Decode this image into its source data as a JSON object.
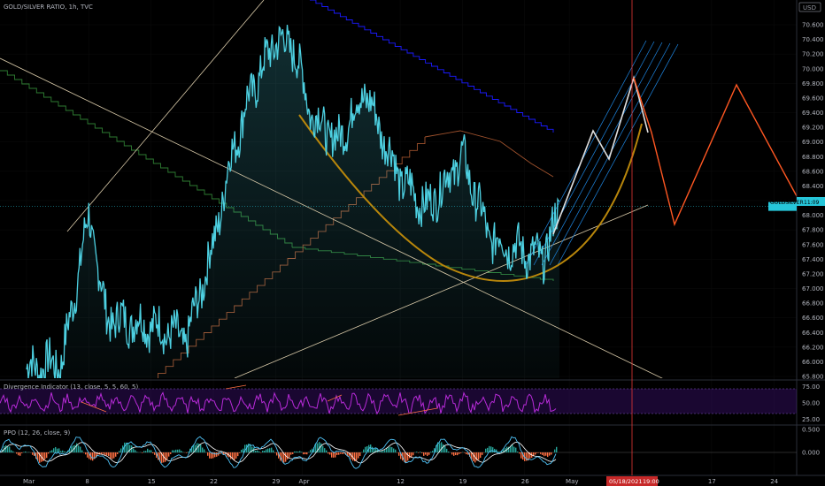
{
  "header": {
    "symbol_title": "GOLD/SILVER RATIO, 1h, TVC",
    "currency": "USD"
  },
  "price_badge": {
    "symbol": "GOLDSILVER",
    "countdown": "11:09",
    "color": "#26c6da"
  },
  "crosshair_time_label": "05/18/2021",
  "crosshair_time_extra": "19:00",
  "colors": {
    "price": "#4dd0e1",
    "divergence": "#b82bd9",
    "ppo_line": "#4fc3f7",
    "ppo_signal": "#ffffff",
    "projection_orange": "#ff5722",
    "projection_white": "#e0e0e0",
    "channel_blue": "#1e88e5",
    "trend_blue": "#1a1aff",
    "trend_green": "#2e7d32",
    "trend_orange": "#a0522d",
    "cup": "#b8860b"
  },
  "chart_data": [
    {
      "type": "line",
      "pane": "price",
      "title": "GOLD/SILVER RATIO, 1h, TVC",
      "y_axis_ticks": [
        "70.600",
        "70.400",
        "70.200",
        "70.000",
        "69.800",
        "69.600",
        "69.400",
        "69.200",
        "69.000",
        "68.800",
        "68.600",
        "68.400",
        "68.200",
        "68.000",
        "67.800",
        "67.600",
        "67.400",
        "67.200",
        "67.000",
        "66.800",
        "66.600",
        "66.400",
        "66.200",
        "66.000",
        "65.800"
      ],
      "ylim": [
        65.8,
        70.8
      ],
      "x_axis_ticks": [
        "Mar",
        "8",
        "15",
        "22",
        "29",
        "Apr",
        "12",
        "19",
        "26",
        "May",
        "17",
        "24"
      ],
      "current_value": 68.12,
      "key_points": {
        "x": [
          "Mar 1",
          "Mar 5",
          "Mar 8",
          "Mar 10",
          "Mar 15",
          "Mar 19",
          "Mar 22",
          "Mar 24",
          "Mar 26",
          "Mar 29",
          "Mar 31",
          "Apr 2",
          "Apr 5",
          "Apr 8",
          "Apr 12",
          "Apr 15",
          "Apr 19",
          "Apr 22",
          "Apr 26",
          "Apr 28",
          "Apr 30"
        ],
        "y": [
          65.9,
          66.0,
          68.0,
          66.6,
          66.5,
          66.3,
          67.6,
          68.8,
          69.6,
          70.4,
          70.3,
          69.4,
          69.0,
          69.7,
          68.5,
          68.1,
          68.8,
          67.7,
          67.5,
          67.4,
          68.1
        ]
      },
      "projection": {
        "x": [
          "May 3",
          "May 7",
          "May 10",
          "May 14",
          "May 17",
          "May 21",
          "May 24",
          "May 28"
        ],
        "y": [
          68.0,
          69.8,
          68.6,
          69.8,
          67.8,
          68.8,
          69.8,
          68.1
        ]
      }
    },
    {
      "type": "line",
      "pane": "divergence",
      "title": "Divergence Indicator (13, close, 5, 5, 60, 5)",
      "y_axis_ticks": [
        "75.00",
        "50.00",
        "25.00"
      ],
      "ylim": [
        20,
        80
      ]
    },
    {
      "type": "line",
      "pane": "ppo",
      "title": "PPO (12, 26, close, 9)",
      "y_axis_ticks": [
        "0.500",
        "0.000"
      ],
      "ylim": [
        -0.45,
        0.6
      ]
    }
  ]
}
